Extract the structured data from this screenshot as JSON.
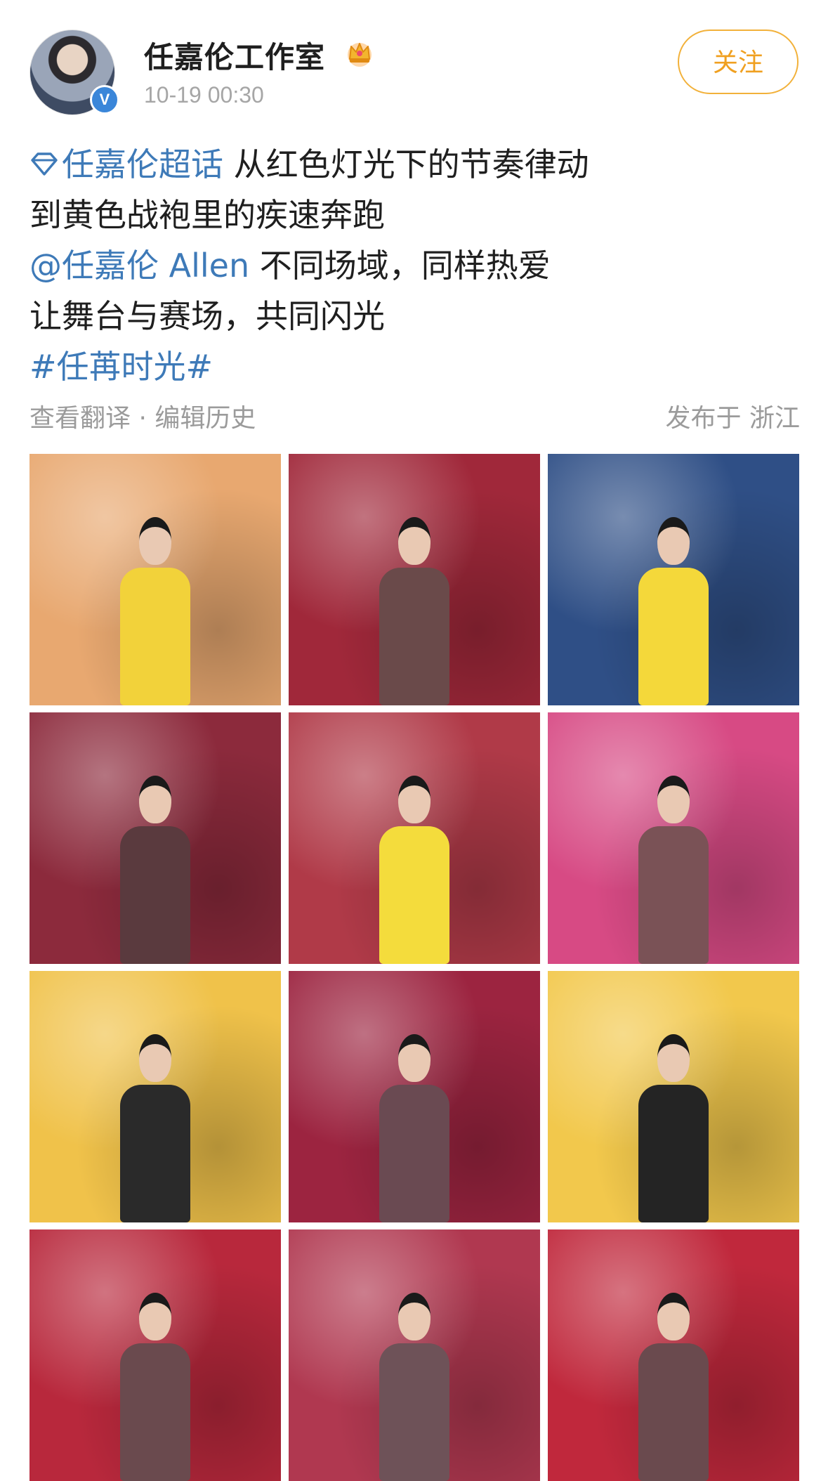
{
  "post": {
    "username": "任嘉伦工作室",
    "timestamp": "10-19 00:30",
    "follow_label": "关注",
    "verified_mark": "V",
    "text": {
      "supertopic": "任嘉伦超话",
      "line1_rest": " 从红色灯光下的节奏律动",
      "line2": "到黄色战袍里的疾速奔跑",
      "mention": "@任嘉伦 Allen",
      "line3_rest": " 不同场域，同样热爱",
      "line4": "让舞台与赛场，共同闪光",
      "hashtag": "#任苒时光#"
    },
    "meta": {
      "translate": "查看翻译",
      "separator": " · ",
      "edit_history": "编辑历史",
      "location": "发布于 浙江"
    }
  },
  "icons": {
    "crown": "crown-icon",
    "supertopic": "diamond-supertopic-icon",
    "verified": "verified-badge-icon"
  },
  "colors": {
    "link": "#3e7ab8",
    "follow": "#f0a020",
    "meta_text": "#9b9b9b",
    "verified": "#3a86d9"
  },
  "photos": [
    {
      "scene": "fog-stage-yellow-jersey",
      "bg": "#e8a870",
      "outfit": "#f2d23a"
    },
    {
      "scene": "red-stage-plaid-suit-mic",
      "bg": "#a0283a",
      "outfit": "#6a4a4a"
    },
    {
      "scene": "arena-blue-seats-basketball",
      "bg": "#2f4f86",
      "outfit": "#f4d83a"
    },
    {
      "scene": "red-stage-plaid-suit",
      "bg": "#8c2a3c",
      "outfit": "#5a3a3e"
    },
    {
      "scene": "yellow-jersey-closeup",
      "bg": "#b03a48",
      "outfit": "#f4dc3c"
    },
    {
      "scene": "pink-stage-plaid-suit",
      "bg": "#d74a84",
      "outfit": "#7a5256"
    },
    {
      "scene": "backdrop-black-suit-umbrella",
      "bg": "#f0c24a",
      "outfit": "#2a2a2a"
    },
    {
      "scene": "red-stage-plaid-suit-mic-2",
      "bg": "#9c2440",
      "outfit": "#6a4a52"
    },
    {
      "scene": "backdrop-black-suit-umbrella-2",
      "bg": "#f2c84c",
      "outfit": "#242424"
    },
    {
      "scene": "red-lights-stage-crowd",
      "bg": "#b8283c",
      "outfit": "#6a4a4e"
    },
    {
      "scene": "red-stage-finger-up",
      "bg": "#b03850",
      "outfit": "#6e5258"
    },
    {
      "scene": "red-lights-crowd-pointing",
      "bg": "#c0283c",
      "outfit": "#6a4a4e"
    }
  ]
}
